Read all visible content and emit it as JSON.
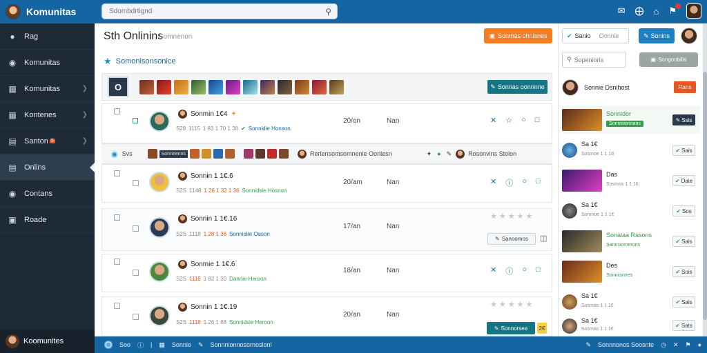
{
  "app": {
    "title": "Komunitas"
  },
  "search": {
    "placeholder": "Sdombdrtignd"
  },
  "sidebar": {
    "items": [
      {
        "label": "Rag",
        "icon": "avatar-icon"
      },
      {
        "label": "Komunitas",
        "icon": "chat-bubble-icon"
      },
      {
        "label": "Komunitas",
        "icon": "gallery-icon"
      },
      {
        "label": "Kontenes",
        "icon": "users-icon"
      },
      {
        "label": "Santon",
        "icon": "document-icon",
        "badge": "5"
      },
      {
        "label": "Onlins",
        "icon": "chart-icon"
      },
      {
        "label": "Contans",
        "icon": "globe-icon"
      },
      {
        "label": "Roade",
        "icon": "lock-icon"
      }
    ],
    "footer": "Koomunites"
  },
  "main": {
    "title": "Sth Onlinins",
    "subtitle": "Somnenon",
    "action_button": "Sonmas ohnisnes",
    "section_title": "Somonisonsonice",
    "toolbar_letter": "O",
    "toolbar_button": "Sonnas oonnnne",
    "strip": {
      "label": "Svs",
      "dark_tag": "Sonneenns",
      "text": "Rerlensomsomnenie Oonlesn",
      "right": "Rosonvins Stolon"
    },
    "rows": [
      {
        "name": "Sonmin 1€4",
        "meta": [
          "S28",
          "1115",
          "1 83 1 70 1 38",
          "Sonnidie Honson"
        ],
        "date": "20/on",
        "col": "Nan",
        "extra": "actions"
      },
      {
        "name": "Sonnin 1 1€.6",
        "meta": [
          "S2S",
          "1148",
          "1 26 1 32 1 36",
          "Sonnidsie Hosnon"
        ],
        "date": "20/am",
        "col": "Nan",
        "extra": "actions"
      },
      {
        "name": "Sonnin 1 1€.16",
        "meta": [
          "S2S",
          "1118",
          "1 28 1 36",
          "Sonnidiie Oason"
        ],
        "date": "17/an",
        "col": "Nan",
        "extra": "button",
        "button": "Sanoomos"
      },
      {
        "name": "Sonmie 1 1€.6",
        "meta": [
          "S2S",
          "1118",
          "1 82 1 30",
          "Dannie Heroon"
        ],
        "date": "18/an",
        "col": "Nan",
        "extra": "actions"
      },
      {
        "name": "Sonnin 1 1€.19",
        "meta": [
          "S2S",
          "1118",
          "1 26 1 68",
          "Sonnidsie Heroon"
        ],
        "date": "20/an",
        "col": "Nan",
        "extra": "teal",
        "button": "Sonnorsee",
        "yellow": "2€"
      }
    ]
  },
  "right": {
    "edit_label": "Sanio",
    "edit_sep": "Oonnie",
    "blue_button": "Sonins",
    "search_placeholder": "Sopenioris",
    "gray_button": "Songonbilis",
    "user_name": "Sonnie Dsnihost",
    "user_button": "Rans",
    "items": [
      {
        "t1": "Sonnidor",
        "t2": "Sonnisiorioans",
        "btn": "Ssis",
        "type": "tag",
        "thumb": "#c2782a"
      },
      {
        "t1": "Sa 1€",
        "t2": "Sosmoe 1 1 18",
        "btn": "Sais",
        "type": "round",
        "thumb": "#2a6ab0"
      },
      {
        "t1": "Das",
        "t2": "Sosmos 1 1 16",
        "btn": "Daie",
        "type": "thumb",
        "thumb": "#9a3ab0"
      },
      {
        "t1": "Sa 1€",
        "t2": "Sonmoe 1 1 1€",
        "btn": "Sos",
        "type": "round",
        "thumb": "#444444"
      },
      {
        "t1": "Sonalaa Rasons",
        "t2": "Sannsiornerons",
        "btn": "Sais",
        "type": "thumb-green",
        "thumb": "#5a5040"
      },
      {
        "t1": "Des",
        "t2": "Sonniisnnes",
        "btn": "Sois",
        "type": "thumb-green2",
        "thumb": "#b0602a"
      },
      {
        "t1": "Sa 1€",
        "t2": "Sosmas 1 1 1€",
        "btn": "Sais",
        "type": "round",
        "thumb": "#7a5a30"
      },
      {
        "t1": "Sa 1€",
        "t2": "Sosmas 1 1 1€",
        "btn": "Sats",
        "type": "round",
        "thumb": "#3a3a3a"
      }
    ]
  },
  "statusbar": {
    "left": [
      "Soo",
      "Sonnio",
      "Sonnnionnosornoslonl"
    ],
    "right": "Sonnnonos Soosnte"
  },
  "colors": {
    "primary": "#1565a3",
    "accent": "#f57c20",
    "teal": "#167585",
    "success": "#2e9e4a",
    "danger": "#e95420"
  }
}
